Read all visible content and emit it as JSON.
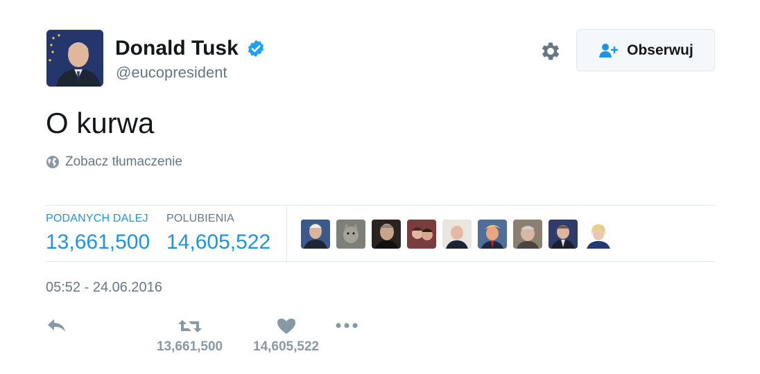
{
  "author": {
    "display_name": "Donald Tusk",
    "handle": "@eucopresident",
    "verified": true,
    "avatar_icon": "profile-photo"
  },
  "follow_button": {
    "label": "Obserwuj",
    "icon": "add-user-icon"
  },
  "settings_icon": "gear-icon",
  "tweet": {
    "text": "O kurwa",
    "translate_label": "Zobacz tłumaczenie",
    "translate_icon": "globe-icon"
  },
  "stats": {
    "retweets_label": "PODANYCH DALEJ",
    "retweets_value": "13,661,500",
    "likes_label": "POLUBIENIA",
    "likes_value": "14,605,522"
  },
  "likers": [
    "liker-avatar-1",
    "liker-avatar-2",
    "liker-avatar-3",
    "liker-avatar-4",
    "liker-avatar-5",
    "liker-avatar-6",
    "liker-avatar-7",
    "liker-avatar-8",
    "liker-avatar-9"
  ],
  "timestamp": "05:52 - 24.06.2016",
  "actions": {
    "retweet_count": "13,661,500",
    "like_count": "14,605,522"
  },
  "colors": {
    "accent": "#1b95e0",
    "muted": "#657786",
    "icon_grey": "#8899a6",
    "verified": "#1da1f2"
  }
}
